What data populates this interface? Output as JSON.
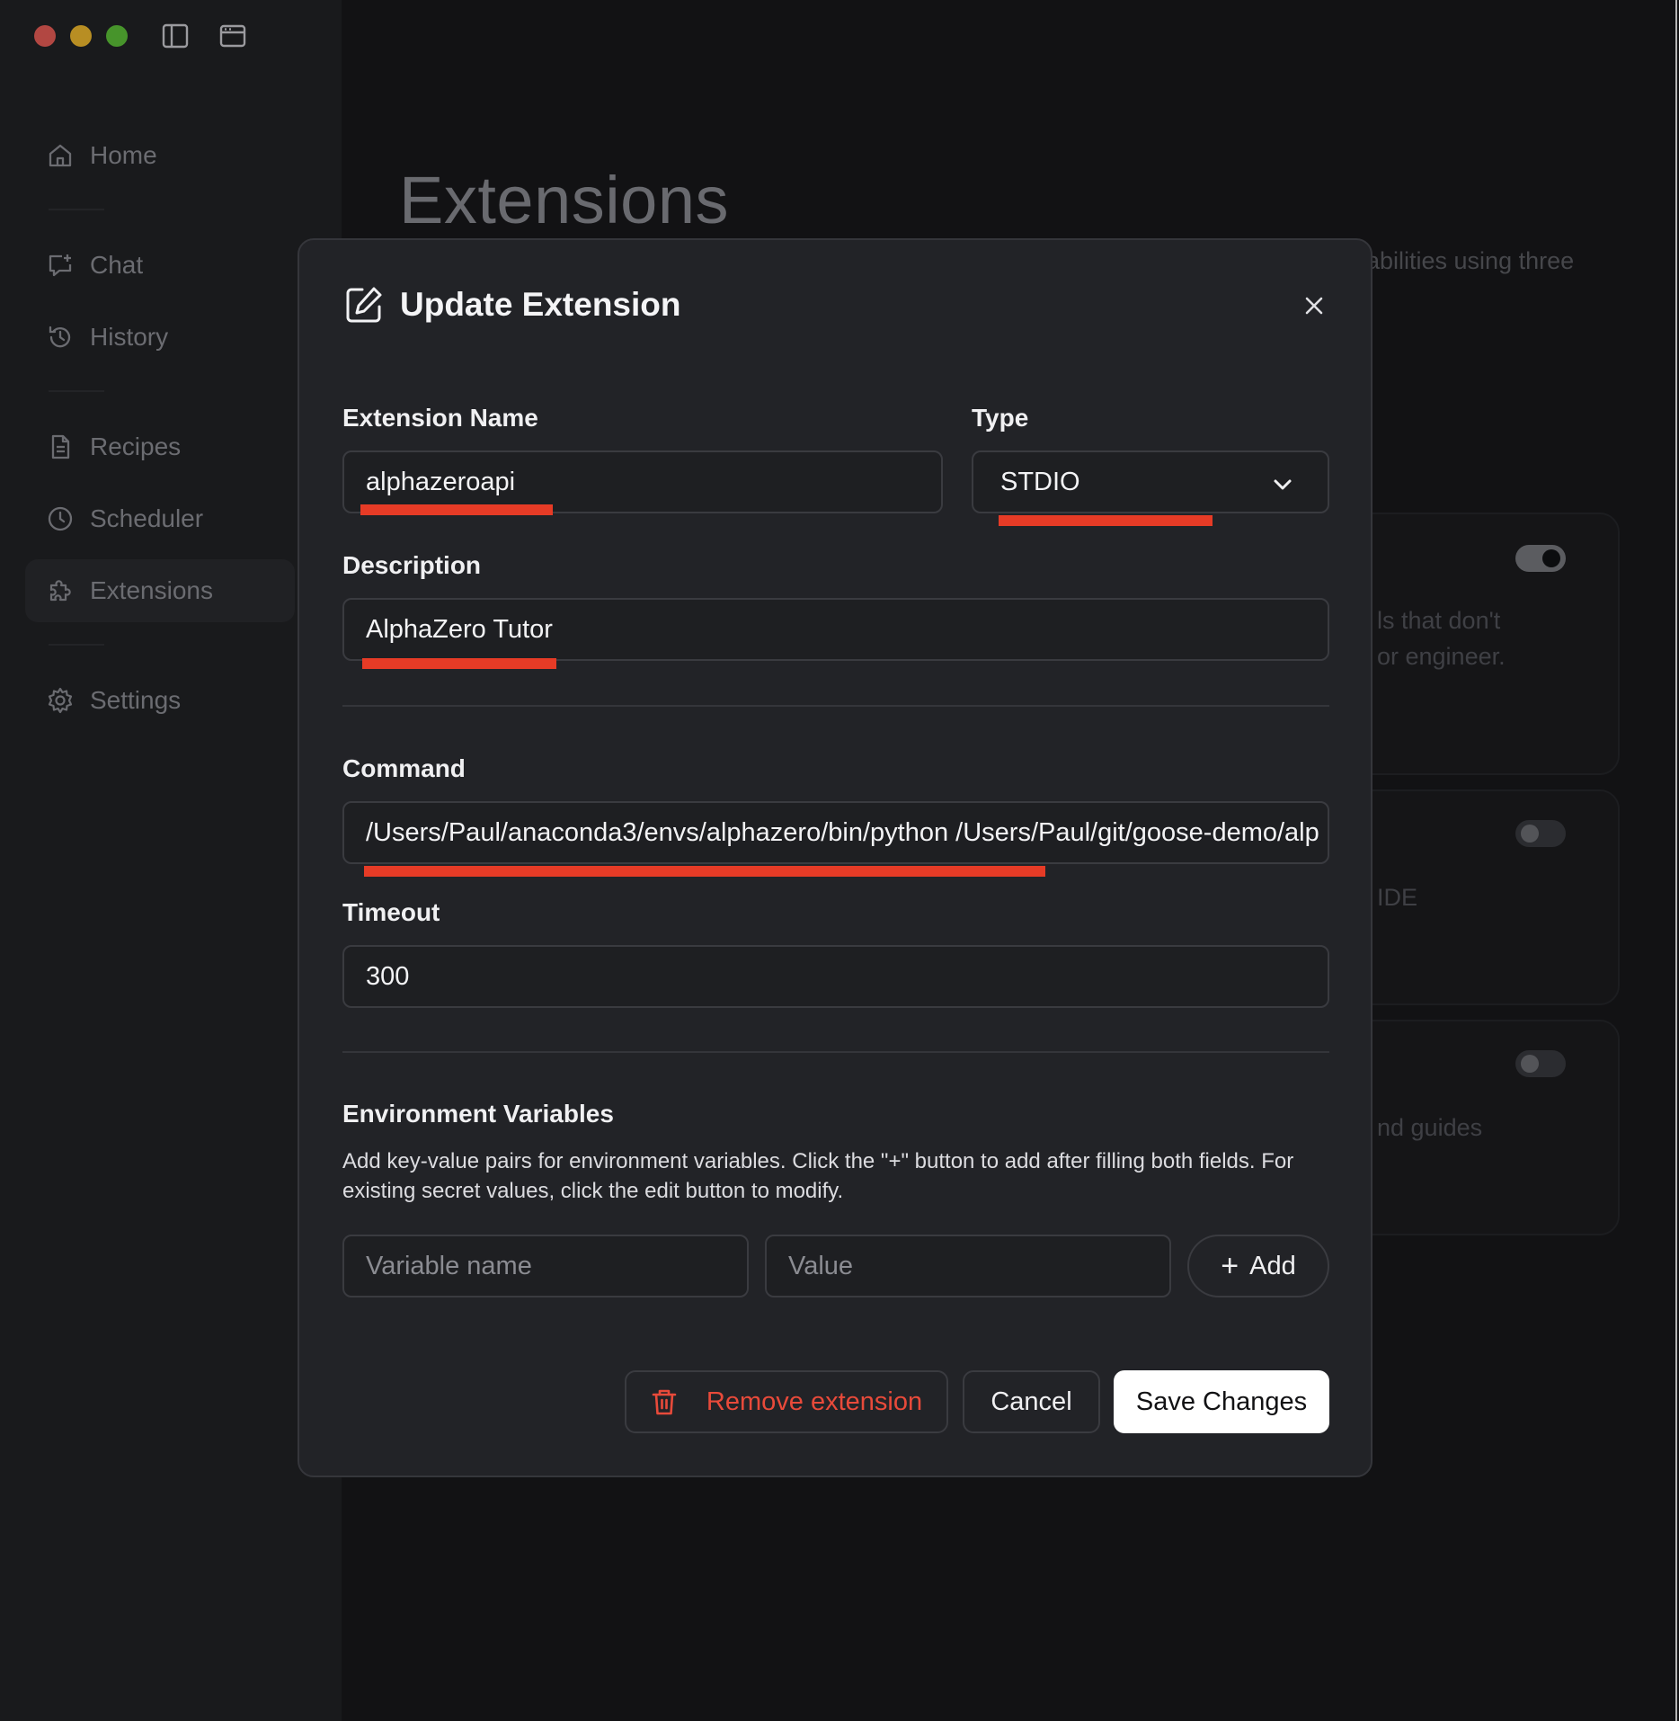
{
  "window": {
    "controls": [
      "close",
      "minimize",
      "maximize"
    ],
    "toolbar_icons": [
      "sidebar-toggle-icon",
      "window-icon"
    ]
  },
  "sidebar": {
    "items": [
      {
        "label": "Home",
        "icon": "home-icon"
      },
      {
        "label": "Chat",
        "icon": "chat-icon"
      },
      {
        "label": "History",
        "icon": "history-icon"
      },
      {
        "label": "Recipes",
        "icon": "recipe-icon"
      },
      {
        "label": "Scheduler",
        "icon": "clock-icon"
      },
      {
        "label": "Extensions",
        "icon": "puzzle-icon",
        "active": true
      },
      {
        "label": "Settings",
        "icon": "gear-icon"
      }
    ]
  },
  "page": {
    "title": "Extensions",
    "subtitle_fragment": "abilities using three",
    "cards": [
      {
        "desc_line1": "ls that don't",
        "desc_line2": "or engineer.",
        "enabled": true
      },
      {
        "desc_line1": "IDE",
        "enabled": false
      },
      {
        "desc_line1": "nd guides",
        "enabled": false
      }
    ]
  },
  "modal": {
    "title": "Update Extension",
    "fields": {
      "name": {
        "label": "Extension Name",
        "value": "alphazeroapi"
      },
      "type": {
        "label": "Type",
        "value": "STDIO"
      },
      "description": {
        "label": "Description",
        "value": "AlphaZero Tutor"
      },
      "command": {
        "label": "Command",
        "value": "/Users/Paul/anaconda3/envs/alphazero/bin/python /Users/Paul/git/goose-demo/alp"
      },
      "timeout": {
        "label": "Timeout",
        "value": "300"
      }
    },
    "env": {
      "label": "Environment Variables",
      "help": "Add key-value pairs for environment variables. Click the \"+\" button to add after filling both fields. For existing secret values, click the edit button to modify.",
      "name_placeholder": "Variable name",
      "value_placeholder": "Value",
      "add_label": "Add"
    },
    "buttons": {
      "remove": "Remove extension",
      "cancel": "Cancel",
      "save": "Save Changes"
    },
    "colors": {
      "highlight": "#e63b26",
      "danger": "#e84a3a"
    }
  }
}
